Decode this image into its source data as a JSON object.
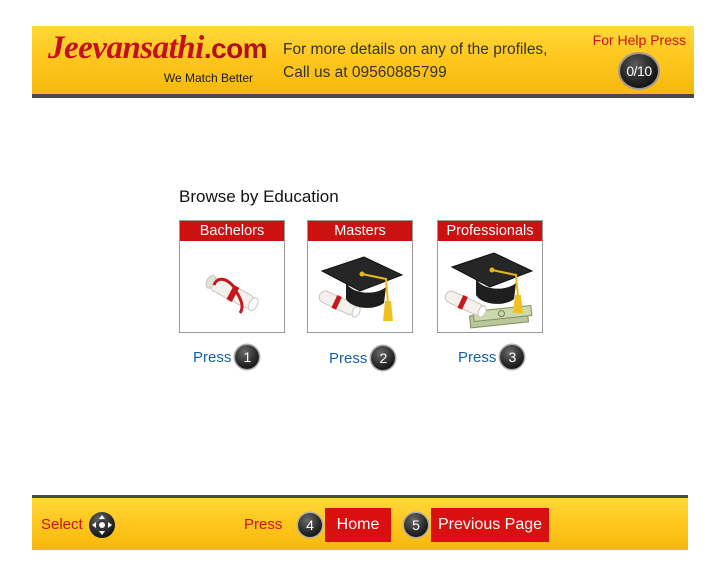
{
  "header": {
    "logo_main": "Jeevansathi",
    "logo_suffix": ".com",
    "logo_tagline": "We Match Better",
    "contact_line1": "For more details on any of the profiles,",
    "contact_line2": "Call us at 09560885799",
    "help_label": "For Help Press",
    "help_badge": "0/10"
  },
  "main": {
    "section_title": "Browse by Education",
    "cards": [
      {
        "label": "Bachelors",
        "image_icon": "diploma-scroll-icon",
        "press_label": "Press",
        "press_number": "1"
      },
      {
        "label": "Masters",
        "image_icon": "graduation-cap-diploma-icon",
        "press_label": "Press",
        "press_number": "2"
      },
      {
        "label": "Professionals",
        "image_icon": "graduation-cap-money-icon",
        "press_label": "Press",
        "press_number": "3"
      }
    ]
  },
  "footer": {
    "select_label": "Select",
    "select_icon": "remote-dpad-icon",
    "press_label": "Press",
    "home_number": "4",
    "home_label": "Home",
    "prev_number": "5",
    "prev_label": "Previous Page"
  },
  "colors": {
    "brand_red": "#cc1111",
    "header_yellow": "#ffc81f",
    "link_blue": "#1560a8"
  }
}
